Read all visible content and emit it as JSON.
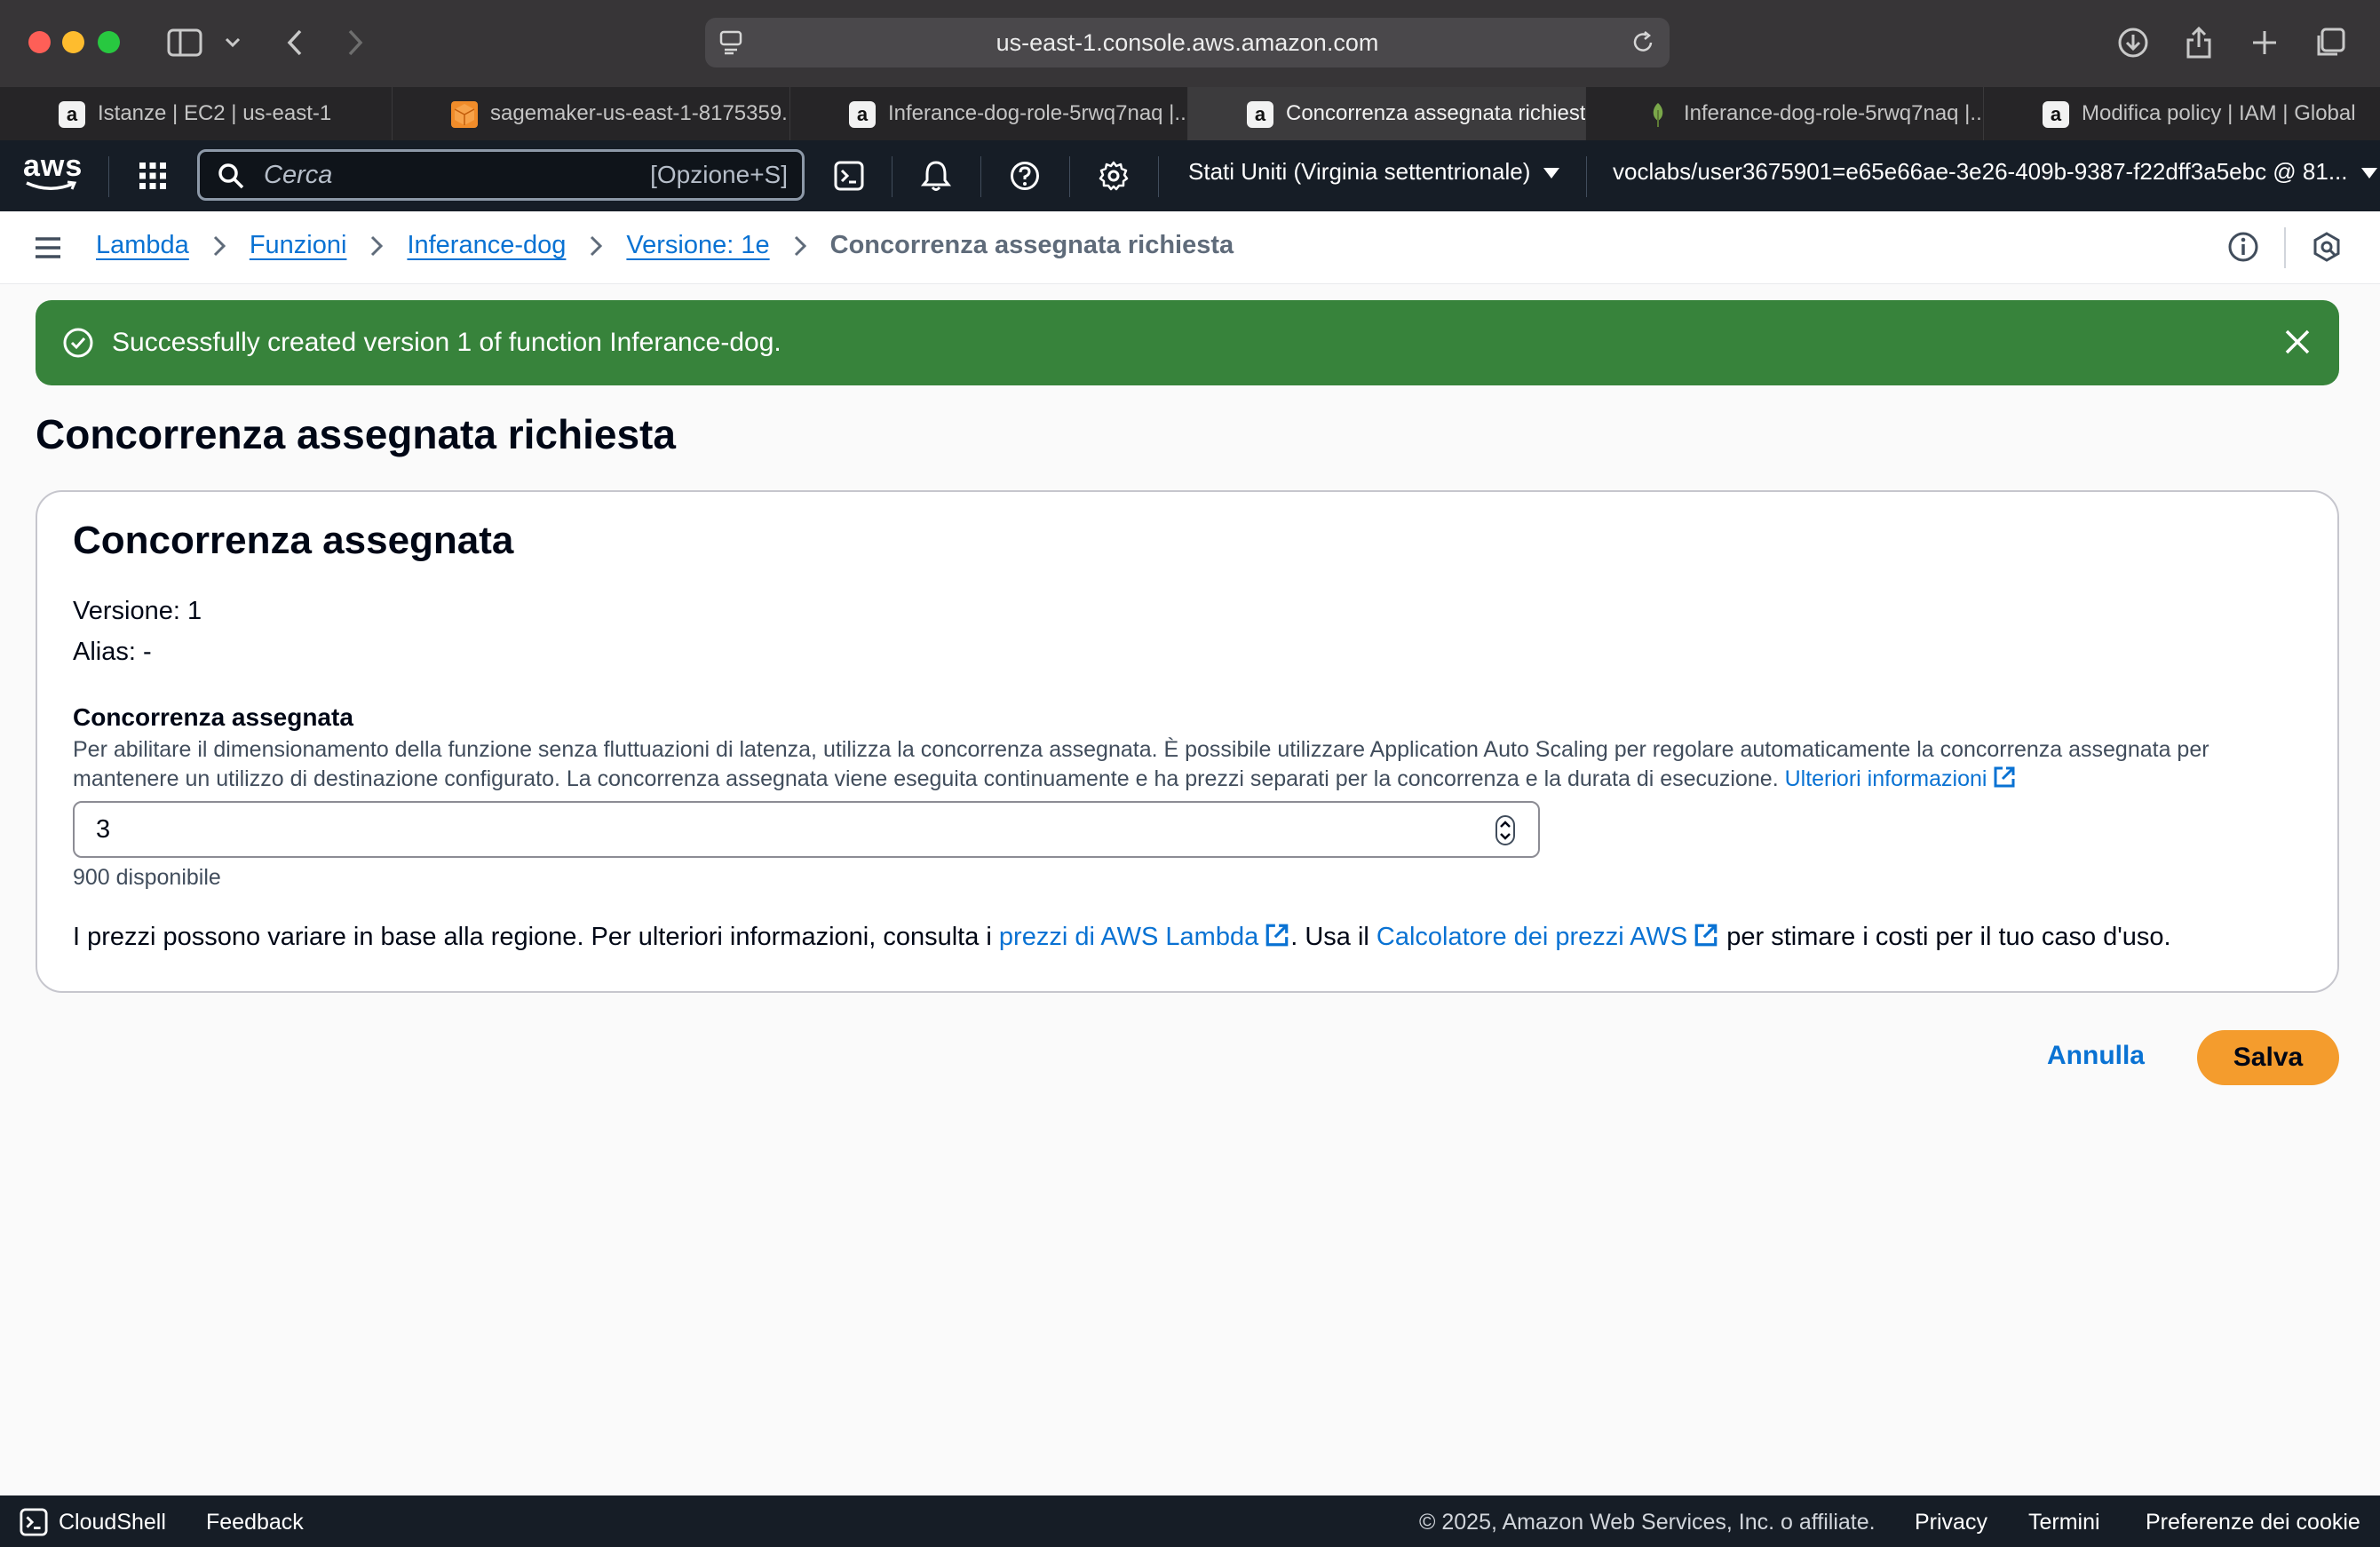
{
  "browser": {
    "url": "us-east-1.console.aws.amazon.com",
    "tabs": [
      {
        "label": "Istanze | EC2 | us-east-1",
        "favicon": "a"
      },
      {
        "label": "sagemaker-us-east-1-8175359...",
        "favicon": "cube"
      },
      {
        "label": "Inferance-dog-role-5rwq7naq |...",
        "favicon": "a"
      },
      {
        "label": "Concorrenza assegnata richiest...",
        "favicon": "a"
      },
      {
        "label": "Inferance-dog-role-5rwq7naq |...",
        "favicon": "leaf"
      },
      {
        "label": "Modifica policy | IAM | Global",
        "favicon": "a"
      }
    ]
  },
  "nav": {
    "logo_text": "aws",
    "search_placeholder": "Cerca",
    "search_shortcut": "[Opzione+S]",
    "region": "Stati Uniti (Virginia settentrionale)",
    "account": "voclabs/user3675901=e65e66ae-3e26-409b-9387-f22dff3a5ebc @ 81..."
  },
  "breadcrumbs": {
    "items": [
      "Lambda",
      "Funzioni",
      "Inferance-dog",
      "Versione: 1e"
    ],
    "current": "Concorrenza assegnata richiesta"
  },
  "flash": {
    "message": "Successfully created version 1 of function Inferance-dog.",
    "color": "#37833b"
  },
  "page": {
    "title": "Concorrenza assegnata richiesta"
  },
  "container": {
    "heading": "Concorrenza assegnata",
    "version": "Versione: 1",
    "alias": "Alias: -",
    "field_label": "Concorrenza assegnata",
    "field_description": "Per abilitare il dimensionamento della funzione senza fluttuazioni di latenza, utilizza la concorrenza assegnata. È possibile utilizzare Application Auto Scaling per regolare automaticamente la concorrenza assegnata per mantenere un utilizzo di destinazione configurato. La concorrenza assegnata viene eseguita continuamente e ha prezzi separati per la concorrenza e la durata di esecuzione. ",
    "learn_more": "Ulteriori informazioni",
    "input_value": "3",
    "available": "900 disponibile",
    "pricing_1": "I prezzi possono variare in base alla regione. Per ulteriori informazioni, consulta i ",
    "pricing_link_1": "prezzi di AWS Lambda",
    "pricing_2": ". Usa il ",
    "pricing_link_2": "Calcolatore dei prezzi AWS",
    "pricing_3": " per stimare i costi per il tuo caso d'uso."
  },
  "actions": {
    "cancel": "Annulla",
    "save": "Salva",
    "save_color": "#f49c2d"
  },
  "footer": {
    "cloudshell": "CloudShell",
    "feedback": "Feedback",
    "copyright": "© 2025, Amazon Web Services, Inc. o affiliate.",
    "privacy": "Privacy",
    "terms": "Termini",
    "cookies": "Preferenze dei cookie"
  }
}
